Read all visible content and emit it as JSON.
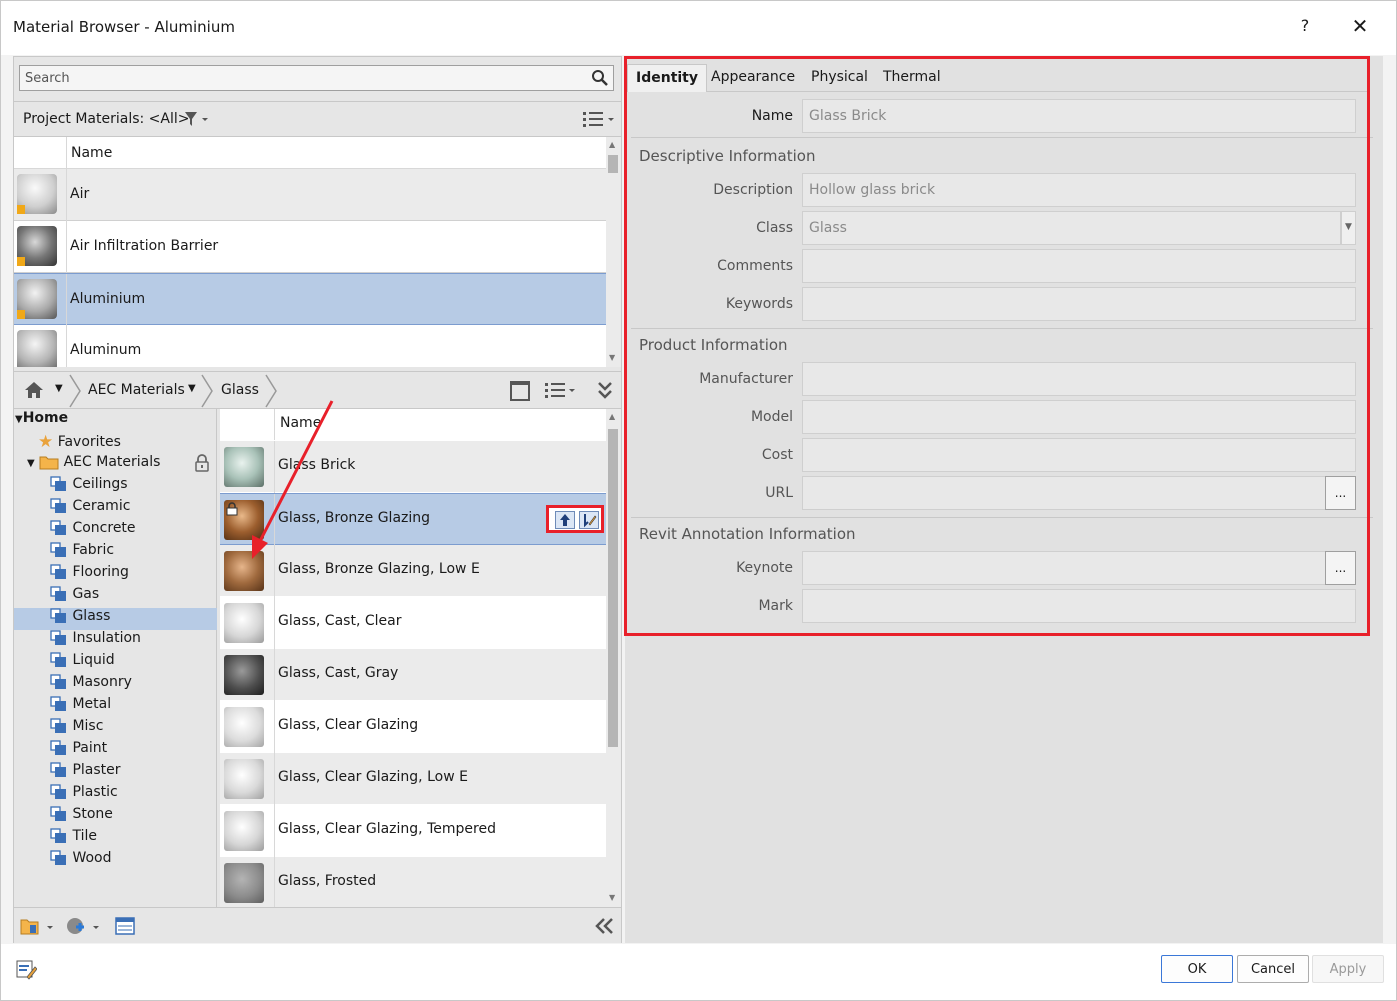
{
  "window": {
    "title": "Material Browser - Aluminium",
    "help_label": "?",
    "close_label": "✕"
  },
  "search": {
    "placeholder": "Search"
  },
  "project": {
    "filter_label": "Project Materials: <All>",
    "column_name": "Name",
    "items": [
      {
        "label": "Air"
      },
      {
        "label": "Air Infiltration Barrier"
      },
      {
        "label": "Aluminium",
        "selected": true
      },
      {
        "label": "Aluminum"
      }
    ]
  },
  "library": {
    "breadcrumb": [
      "AEC Materials",
      "Glass"
    ],
    "tree": {
      "home": "Home",
      "favorites": "Favorites",
      "aec": "AEC Materials",
      "categories": [
        "Ceilings",
        "Ceramic",
        "Concrete",
        "Fabric",
        "Flooring",
        "Gas",
        "Glass",
        "Insulation",
        "Liquid",
        "Masonry",
        "Metal",
        "Misc",
        "Paint",
        "Plaster",
        "Plastic",
        "Stone",
        "Tile",
        "Wood"
      ],
      "selected": "Glass"
    },
    "column_name": "Name",
    "materials": [
      "Glass Brick",
      "Glass, Bronze Glazing",
      "Glass, Bronze Glazing, Low E",
      "Glass, Cast, Clear",
      "Glass, Cast, Gray",
      "Glass, Clear Glazing",
      "Glass, Clear Glazing, Low E",
      "Glass, Clear Glazing, Tempered",
      "Glass, Frosted"
    ],
    "selected_material": "Glass, Bronze Glazing"
  },
  "editor": {
    "tabs": [
      "Identity",
      "Appearance",
      "Physical",
      "Thermal"
    ],
    "active_tab": "Identity",
    "name_label": "Name",
    "name_value": "Glass Brick",
    "sections": {
      "descriptive": "Descriptive Information",
      "product": "Product Information",
      "revit": "Revit Annotation Information"
    },
    "fields": {
      "description_label": "Description",
      "description_value": "Hollow glass brick",
      "class_label": "Class",
      "class_value": "Glass",
      "comments_label": "Comments",
      "keywords_label": "Keywords",
      "manufacturer_label": "Manufacturer",
      "model_label": "Model",
      "cost_label": "Cost",
      "url_label": "URL",
      "keynote_label": "Keynote",
      "mark_label": "Mark",
      "browse_label": "..."
    }
  },
  "footer": {
    "ok": "OK",
    "cancel": "Cancel",
    "apply": "Apply"
  },
  "colors": {
    "selection": "#b7cbe5",
    "annotation_red": "#e8202a",
    "folder_blue": "#3a6fb6"
  }
}
